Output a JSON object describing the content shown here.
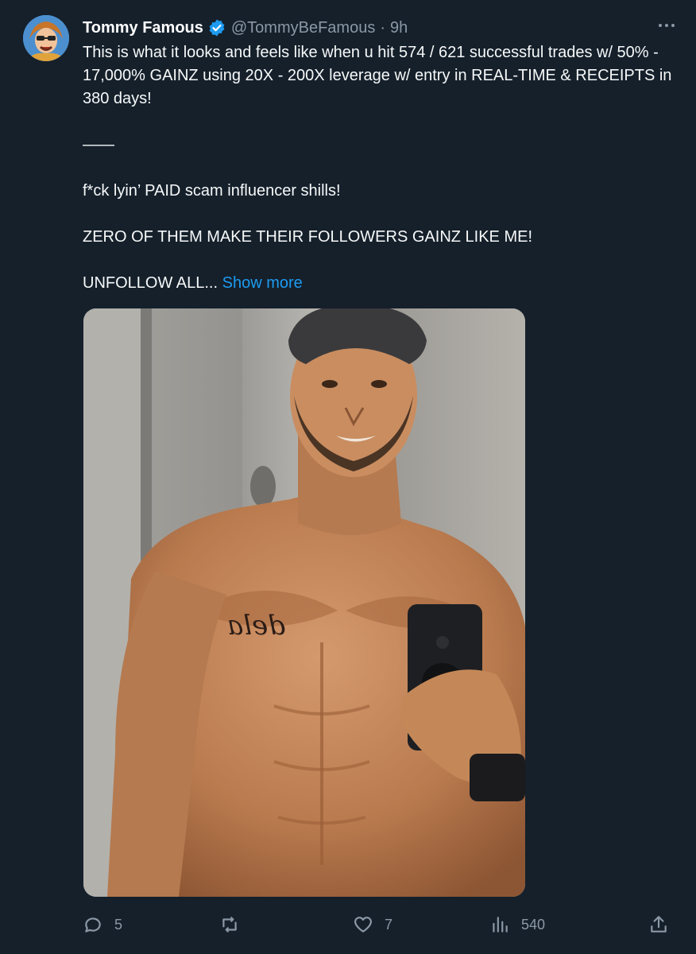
{
  "tweet": {
    "author": {
      "display_name": "Tommy Famous",
      "verified_icon": "verified-badge-icon",
      "handle": "@TommyBeFamous",
      "separator": "·",
      "time": "9h"
    },
    "more_icon": "more-options-icon",
    "text": {
      "line1": "This is what it looks and feels like when u hit 574 / 621 successful trades w/ 50% - 17,000% GAINZ using 20X - 200X leverage w/ entry in REAL-TIME & RECEIPTS in 380 days!",
      "divider": "——",
      "line2": "f*ck lyin’ PAID scam influencer shills!",
      "line3": "ZERO OF THEM MAKE THEIR FOLLOWERS GAINZ LIKE ME!",
      "line4": "UNFOLLOW ALL...",
      "show_more": "Show more"
    },
    "tattoo_text": "dela",
    "actions": {
      "reply_icon": "reply-icon",
      "reply_count": "5",
      "retweet_icon": "retweet-icon",
      "retweet_count": "",
      "like_icon": "heart-icon",
      "like_count": "7",
      "views_icon": "views-chart-icon",
      "views_count": "540",
      "share_icon": "share-icon"
    },
    "colors": {
      "background": "#15202b",
      "text": "#f7f9f9",
      "muted": "#8b98a5",
      "link": "#1d9bf0",
      "verified": "#1d9bf0"
    }
  }
}
